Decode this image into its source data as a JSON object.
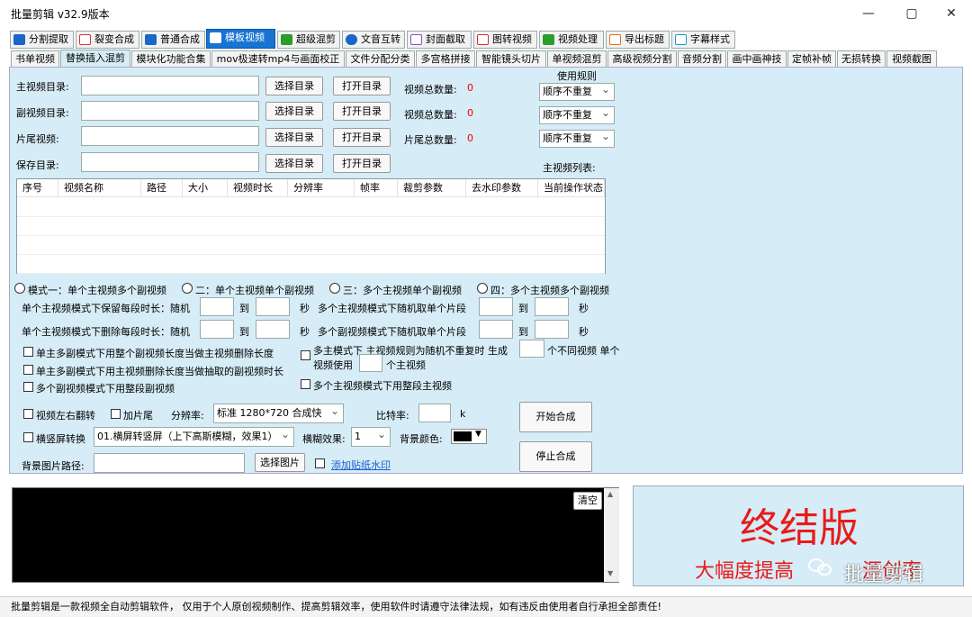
{
  "window": {
    "title": "批量剪辑   v32.9版本",
    "minimize": "—",
    "maximize": "▢",
    "close": "✕"
  },
  "top_tabs": [
    {
      "label": "分割提取",
      "color": "#1a66c9"
    },
    {
      "label": "裂变合成",
      "color": "#d33"
    },
    {
      "label": "普通合成",
      "color": "#1a66c9"
    },
    {
      "label": "模板视频",
      "color": "#ffffff"
    },
    {
      "label": "超级混剪",
      "color": "#2a9d2a"
    },
    {
      "label": "文音互转",
      "color": "#1a66c9"
    },
    {
      "label": "封面截取",
      "color": "#8a4fbf"
    },
    {
      "label": "图转视频",
      "color": "#c33"
    },
    {
      "label": "视频处理",
      "color": "#2a9d2a"
    },
    {
      "label": "导出标题",
      "color": "#e07020"
    },
    {
      "label": "字幕样式",
      "color": "#1a99c9"
    }
  ],
  "sub_tabs": [
    "书单视频",
    "替换插入混剪",
    "模块化功能合集",
    "mov极速转mp4与画面校正",
    "文件分配分类",
    "多宫格拼接",
    "智能镜头切片",
    "单视频混剪",
    "高级视频分割",
    "音频分割",
    "画中画神技",
    "定帧补帧",
    "无损转换",
    "视频截图"
  ],
  "form": {
    "main_dir_label": "主视频目录:",
    "sub_dir_label": "副视频目录:",
    "tail_label": "片尾视频:",
    "save_dir_label": "保存目录:",
    "choose_dir": "选择目录",
    "open_dir": "打开目录",
    "video_total_label": "视频总数量:",
    "tail_total_label": "片尾总数量:",
    "count_main": "0",
    "count_sub": "0",
    "count_tail": "0",
    "rule_title": "使用规则",
    "rule_value": "顺序不重复",
    "main_list_label": "主视频列表:"
  },
  "table": {
    "headers": [
      "序号",
      "视频名称",
      "路径",
      "大小",
      "视频时长",
      "分辨率",
      "帧率",
      "裁剪参数",
      "去水印参数",
      "当前操作状态"
    ]
  },
  "modes": [
    "模式一：单个主视频多个副视频",
    "二：单个主视频单个副视频",
    "三：多个主视频单个副视频",
    "四：多个主视频多个副视频"
  ],
  "options": {
    "keep_len": "单个主视频模式下保留每段时长：随机",
    "del_len": "单个主视频模式下删除每段时长：随机",
    "to": "到",
    "sec": "秒",
    "multi_main_rand": "多个主视频模式下随机取单个片段",
    "multi_sub_rand": "多个副视频模式下随机取单个片段",
    "chk1": "单主多副模式下用整个副视频长度当做主视频删除长度",
    "chk2": "单主多副模式下用主视频删除长度当做抽取的副视频时长",
    "chk3": "多个副视频模式下用整段副视频",
    "chk4a": "多主模式下 主视频规则为随机不重复时 生成",
    "chk4b": "个不同视频 单个",
    "chk4c": "视频使用",
    "chk4d": "个主视频",
    "chk5": "多个主视频模式下用整段主视频",
    "flip": "视频左右翻转",
    "add_tail": "加片尾",
    "resolution_label": "分辨率:",
    "resolution_value": "标准 1280*720 合成快",
    "bitrate_label": "比特率:",
    "bitrate_unit": "k",
    "orient": "横竖屏转换",
    "orient_value": "01.横屏转竖屏（上下高斯模糊，效果1）",
    "blur_label": "横糊效果:",
    "blur_value": "1",
    "bg_color_label": "背景颜色:",
    "bg_path_label": "背景图片路径:",
    "choose_image": "选择图片",
    "add_sticker": "添加贴纸水印",
    "start": "开始合成",
    "stop": "停止合成"
  },
  "console": {
    "clear": "清空"
  },
  "ad": {
    "title": "终结版",
    "subtitle": "大幅度提高",
    "subtitle_tail": "源创率",
    "brand": "批量剪辑"
  },
  "status": "批量剪辑是一款视频全自动剪辑软件， 仅用于个人原创视频制作、提高剪辑效率，使用软件时请遵守法律法规，如有违反由使用者自行承担全部责任!",
  "colors": {
    "panel": "#d6ecf6",
    "accent": "#1874d2",
    "ad_red": "#e81b1b"
  }
}
